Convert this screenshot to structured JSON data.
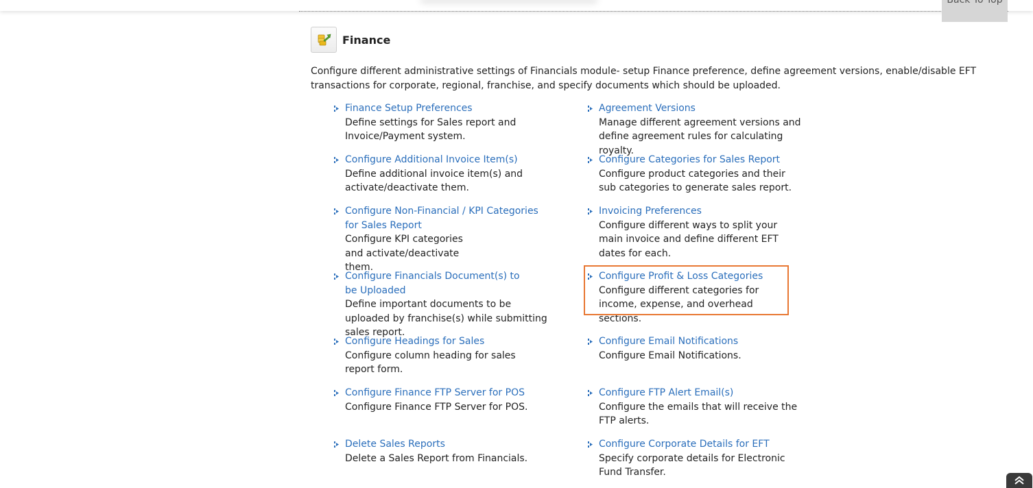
{
  "header": {
    "back_to_top": "Back To Top"
  },
  "section": {
    "title": "Finance",
    "intro": "Configure different administrative settings of Financials module- setup Finance preference, define agreement versions, enable/disable EFT transactions for corporate, regional, franchise, and specify documents which should be uploaded."
  },
  "left_items": [
    {
      "link": "Finance Setup Preferences",
      "desc": "Define settings for Sales report and Invoice/Payment system."
    },
    {
      "link": "Configure Additional Invoice Item(s)",
      "desc": "Define additional invoice item(s) and activate/deactivate them."
    },
    {
      "link": "Configure Non-Financial / KPI Categories for Sales Report",
      "desc": "Configure KPI categories and activate/deactivate them."
    },
    {
      "link": "Configure Financials Document(s) to be Uploaded",
      "desc": "Define important documents to be uploaded by franchise(s) while submitting sales report."
    },
    {
      "link": "Configure Headings for Sales",
      "desc": "Configure column heading for sales report form."
    },
    {
      "link": "Configure Finance FTP Server for POS",
      "desc": "Configure Finance FTP Server for POS."
    },
    {
      "link": "Delete Sales Reports",
      "desc": "Delete a Sales Report from Financials."
    }
  ],
  "right_items": [
    {
      "link": "Agreement Versions",
      "desc": "Manage different agreement versions and define agreement rules for calculating royalty."
    },
    {
      "link": "Configure Categories for Sales Report",
      "desc": "Configure product categories and their sub categories to generate sales report."
    },
    {
      "link": "Invoicing Preferences",
      "desc": "Configure different ways to split your main invoice and define different EFT dates for each."
    },
    {
      "link": "Configure Profit & Loss Categories",
      "desc": "Configure different categories for income, expense, and overhead sections."
    },
    {
      "link": "Configure Email Notifications",
      "desc": "Configure Email Notifications."
    },
    {
      "link": "Configure FTP Alert Email(s)",
      "desc": "Configure the emails that will receive the FTP alerts."
    },
    {
      "link": "Configure Corporate Details for EFT",
      "desc": "Specify corporate details for Electronic Fund Transfer."
    }
  ],
  "colors": {
    "link": "#2a6ebb",
    "highlight": "#e87732",
    "text": "#222222"
  },
  "icons": {
    "section": "finance-icon",
    "bullet": "bullet-arrow-icon",
    "scroll": "chevron-up-double-icon"
  }
}
